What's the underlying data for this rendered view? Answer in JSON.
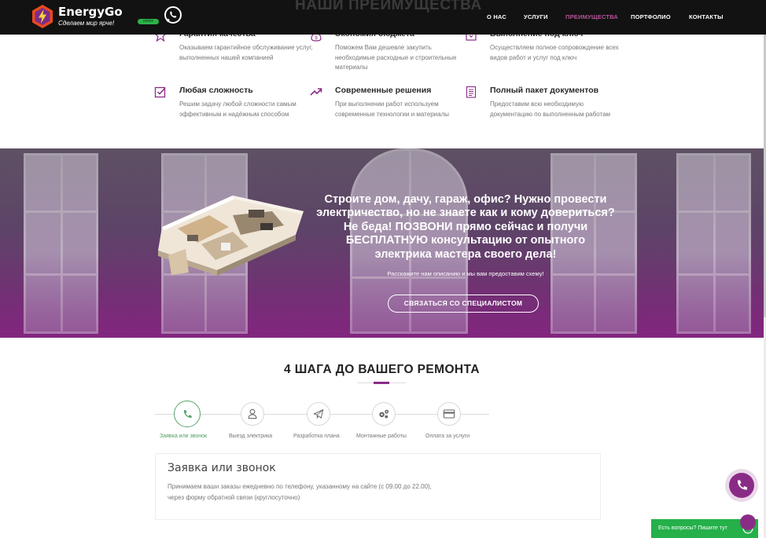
{
  "brand": {
    "name": "EnergyGo",
    "slogan": "Сделаем мир ярче!",
    "online_badge": "online",
    "accent_color": "#8a2c86",
    "green_color": "#25b04a"
  },
  "nav": {
    "items": [
      "О НАС",
      "УСЛУГИ",
      "ПРЕИМУЩЕСТВА",
      "ПОРТФОЛИО",
      "КОНТАКТЫ"
    ],
    "active": "ПРЕИМУЩЕСТВА"
  },
  "advantages": {
    "section_title": "НАШИ ПРЕИМУЩЕСТВА",
    "items": [
      {
        "icon": "star-icon",
        "title": "Гарантия качества",
        "text": "Оказываем гарантийное обслуживание услуг, выполненных нашей компанией"
      },
      {
        "icon": "money-bag-icon",
        "title": "Экономия бюджета",
        "text": "Поможем Вам дешевле закупить необходимые расходные и строительные материалы"
      },
      {
        "icon": "key-box-icon",
        "title": "Выполнение под ключ",
        "text": "Осуществляем полное сопровождение всех видов работ и услуг под ключ"
      },
      {
        "icon": "checkbox-icon",
        "title": "Любая сложность",
        "text": "Решим задачу любой сложности самым эффективным и надёжным способом"
      },
      {
        "icon": "trend-up-icon",
        "title": "Современные решения",
        "text": "При выполнении работ используем современные технологии и материалы"
      },
      {
        "icon": "document-icon",
        "title": "Полный пакет документов",
        "text": "Предоставим всю необходимую документацию по выполненным работам"
      }
    ]
  },
  "banner": {
    "headline": "Строите дом, дачу, гараж, офис? Нужно провести электричество, но не знаете как и кому довериться? Не беда! ПОЗВОНИ прямо сейчас и получи БЕСПЛАТНУЮ консультацию от опытного электрика мастера своего дела!",
    "subtext": "Расскажите нам описанию и мы вам предоставим схему!",
    "cta_label": "СВЯЗАТЬСЯ СО СПЕЦИАЛИСТОМ"
  },
  "steps": {
    "title": "4 ШАГА ДО ВАШЕГО РЕМОНТА",
    "items": [
      {
        "icon": "phone-icon",
        "label": "Заявка или звонок"
      },
      {
        "icon": "user-icon",
        "label": "Выезд электрика"
      },
      {
        "icon": "paper-plane-icon",
        "label": "Разработка плана"
      },
      {
        "icon": "gears-icon",
        "label": "Монтажные работы"
      },
      {
        "icon": "credit-card-icon",
        "label": "Оплата за услуги"
      }
    ],
    "active_index": 0,
    "card": {
      "title": "Заявка или звонок",
      "text": "Принимаем ваши заказы ежедневно по телефону, указанному на сайте (с 09.00 до 22.00), через форму обратной связи (круглосуточно)"
    }
  },
  "chat_widget": {
    "label": "Есть вопросы? Пишите тут"
  }
}
